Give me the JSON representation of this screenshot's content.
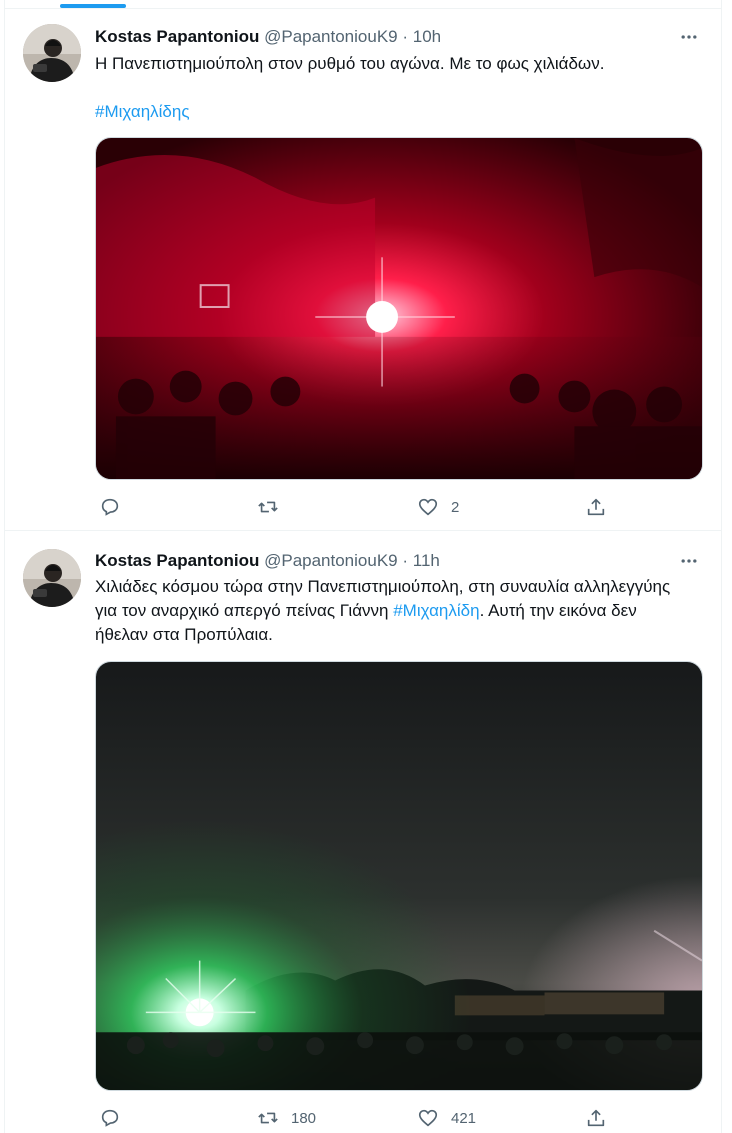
{
  "tweets": [
    {
      "author_name": "Kostas Papantoniou",
      "handle": "@PapantoniouK9",
      "separator": "·",
      "time": "10h",
      "text": "Η Πανεπιστημιούπολη στον ρυθμό του αγώνα. Με το φως χιλιάδων.",
      "hashtag": "#Μιχαηλίδης",
      "media": {
        "alt_icon": "photo-red-flare-crowd"
      },
      "actions": {
        "reply_count": "",
        "retweet_count": "",
        "like_count": "2"
      }
    },
    {
      "author_name": "Kostas Papantoniou",
      "handle": "@PapantoniouK9",
      "separator": "·",
      "time": "11h",
      "text_before": "Χιλιάδες κόσμου τώρα στην Πανεπιστημιούπολη, στη συναυλία αλληλεγγύης για τον αναρχικό απεργό πείνας Γιάννη ",
      "hashtag": "#Μιχαηλίδη",
      "text_after": ". Αυτή την εικόνα δεν ήθελαν στα Προπύλαια.",
      "media": {
        "alt_icon": "photo-night-crowd-green-light"
      },
      "actions": {
        "reply_count": "",
        "retweet_count": "180",
        "like_count": "421"
      }
    }
  ],
  "colors": {
    "accent": "#1d9bf0",
    "secondary_text": "#536471",
    "text": "#0f1419",
    "border": "#eff3f4"
  },
  "icons": [
    "more-icon",
    "reply-icon",
    "retweet-icon",
    "like-icon",
    "share-icon"
  ]
}
